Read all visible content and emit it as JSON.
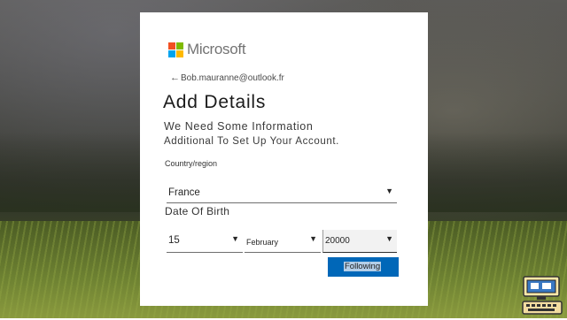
{
  "brand": {
    "name": "Microsoft",
    "colors": [
      "#f25022",
      "#7fba00",
      "#00a4ef",
      "#ffb900"
    ]
  },
  "account": {
    "back_arrow": "←",
    "email": "Bob.mauranne@outlook.fr"
  },
  "form": {
    "title": "Add Details",
    "description_line1": "We Need Some Information",
    "description_line2": "Additional To Set Up Your Account.",
    "country_label": "Country/region",
    "country_value": "France",
    "dob_label": "Date Of Birth",
    "dob_day": "15",
    "dob_month": "February",
    "dob_year": "20000",
    "caret": "▼"
  },
  "actions": {
    "next_label": "Following",
    "accent_color": "#0067b8"
  },
  "badge": {
    "icon": "computer-keyboard-icon"
  }
}
